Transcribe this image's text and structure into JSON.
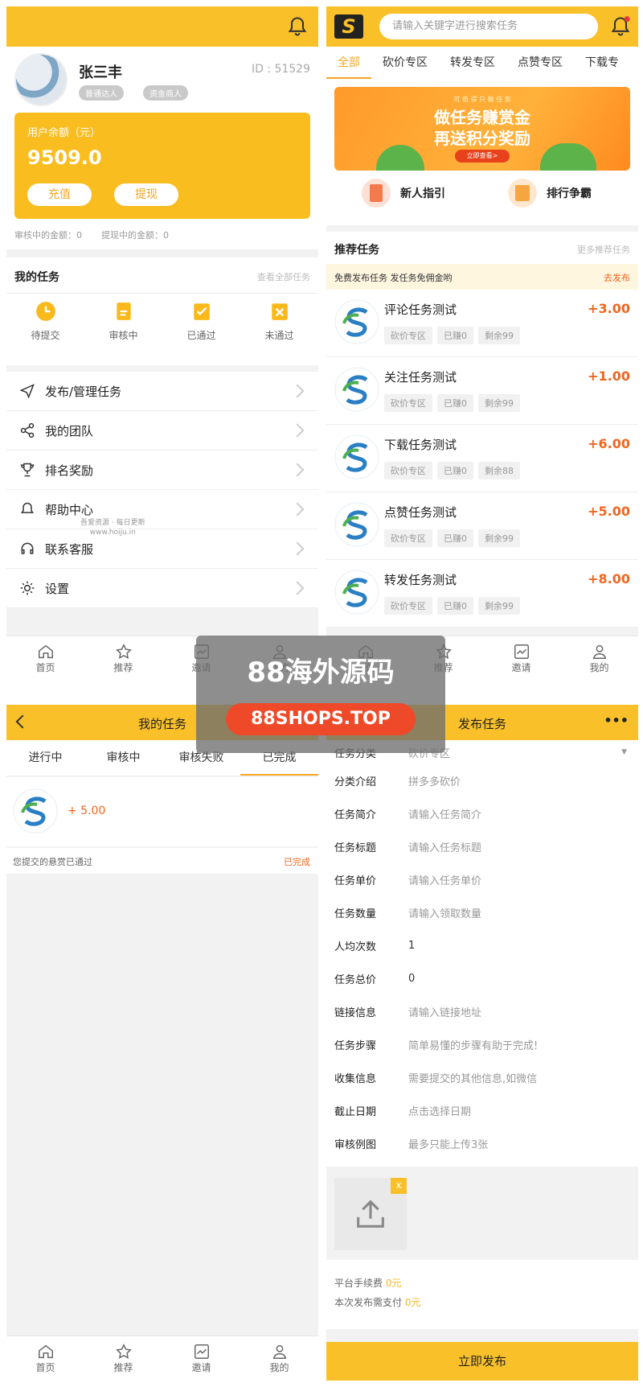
{
  "colors": {
    "accent": "#f9c02a",
    "orange": "#f0661f",
    "red_btn": "#ee4a2a"
  },
  "profile": {
    "name": "张三丰",
    "id_text": "ID : 51529",
    "badge1": "普通达人",
    "badge2": "资金商人",
    "balance_label": "用户余额（元）",
    "balance": "9509.0",
    "recharge": "充值",
    "withdraw": "提现",
    "review_amount": "审核中的金额：0",
    "withdraw_amount": "提现中的金额：0"
  },
  "my_tasks": {
    "title": "我的任务",
    "view_all": "查看全部任务",
    "items": [
      {
        "label": "待提交",
        "icon": "clock-icon"
      },
      {
        "label": "审核中",
        "icon": "document-icon"
      },
      {
        "label": "已通过",
        "icon": "check-icon"
      },
      {
        "label": "未通过",
        "icon": "cross-icon"
      }
    ]
  },
  "menu": [
    {
      "label": "发布/管理任务",
      "icon": "send-icon"
    },
    {
      "label": "我的团队",
      "icon": "share-icon"
    },
    {
      "label": "排名奖励",
      "icon": "trophy-icon"
    },
    {
      "label": "帮助中心",
      "icon": "bell-icon"
    },
    {
      "label": "联系客服",
      "icon": "headset-icon"
    },
    {
      "label": "设置",
      "icon": "settings-icon"
    }
  ],
  "watermark_small": {
    "line1": "吾爱资源 · 每日更新",
    "line2": "www.hoiju.in"
  },
  "tabbar": [
    "首页",
    "推荐",
    "邀请",
    "我的"
  ],
  "search": {
    "placeholder": "请输入关键字进行搜索任务"
  },
  "categories": [
    "全部",
    "砍价专区",
    "转发专区",
    "点赞专区",
    "下载专"
  ],
  "banner": {
    "small": "可 值 得 只 做 任 务",
    "line1": "做任务赚赏金",
    "line2": "再送积分奖励",
    "cta": "立即查看>"
  },
  "quick_links": [
    "新人指引",
    "排行争霸"
  ],
  "recommend": {
    "title": "推荐任务",
    "more": "更多推荐任务",
    "notice": "免费发布任务 发任务免佣金哟",
    "notice_link": "去发布",
    "tasks": [
      {
        "title": "评论任务测试",
        "cat": "砍价专区",
        "earned": "已赚0",
        "left": "剩余99",
        "reward": "+3.00"
      },
      {
        "title": "关注任务测试",
        "cat": "砍价专区",
        "earned": "已赚0",
        "left": "剩余99",
        "reward": "+1.00"
      },
      {
        "title": "下载任务测试",
        "cat": "砍价专区",
        "earned": "已赚0",
        "left": "剩余88",
        "reward": "+6.00"
      },
      {
        "title": "点赞任务测试",
        "cat": "砍价专区",
        "earned": "已赚0",
        "left": "剩余99",
        "reward": "+5.00"
      },
      {
        "title": "转发任务测试",
        "cat": "砍价专区",
        "earned": "已赚0",
        "left": "剩余99",
        "reward": "+8.00"
      }
    ]
  },
  "watermark": {
    "line1": "88海外源码",
    "line2": "88SHOPS.TOP"
  },
  "mytask_page": {
    "title": "我的任务",
    "tabs": [
      "进行中",
      "审核中",
      "审核失败",
      "已完成"
    ],
    "reward": "+ 5.00",
    "status_text": "您提交的悬赏已通过",
    "status": "已完成"
  },
  "publish_page": {
    "title": "发布任务",
    "more": "•••",
    "fields": [
      {
        "k": "任务分类",
        "v": "砍价专区"
      },
      {
        "k": "分类介绍",
        "v": "拼多多砍价"
      },
      {
        "k": "任务简介",
        "v": "请输入任务简介"
      },
      {
        "k": "任务标题",
        "v": "请输入任务标题"
      },
      {
        "k": "任务单价",
        "v": "请输入任务单价"
      },
      {
        "k": "任务数量",
        "v": "请输入领取数量"
      },
      {
        "k": "人均次数",
        "v": "1"
      },
      {
        "k": "任务总价",
        "v": "0"
      },
      {
        "k": "链接信息",
        "v": "请输入链接地址"
      },
      {
        "k": "任务步骤",
        "v": "简单易懂的步骤有助于完成!"
      },
      {
        "k": "收集信息",
        "v": "需要提交的其他信息,如微信"
      },
      {
        "k": "截止日期",
        "v": "点击选择日期"
      },
      {
        "k": "审核例图",
        "v": "最多只能上传3张"
      }
    ],
    "fee_label": "平台手续费",
    "fee": "0元",
    "pay_label": "本次发布需支付",
    "pay": "0元",
    "submit": "立即发布",
    "upload_close": "x"
  }
}
